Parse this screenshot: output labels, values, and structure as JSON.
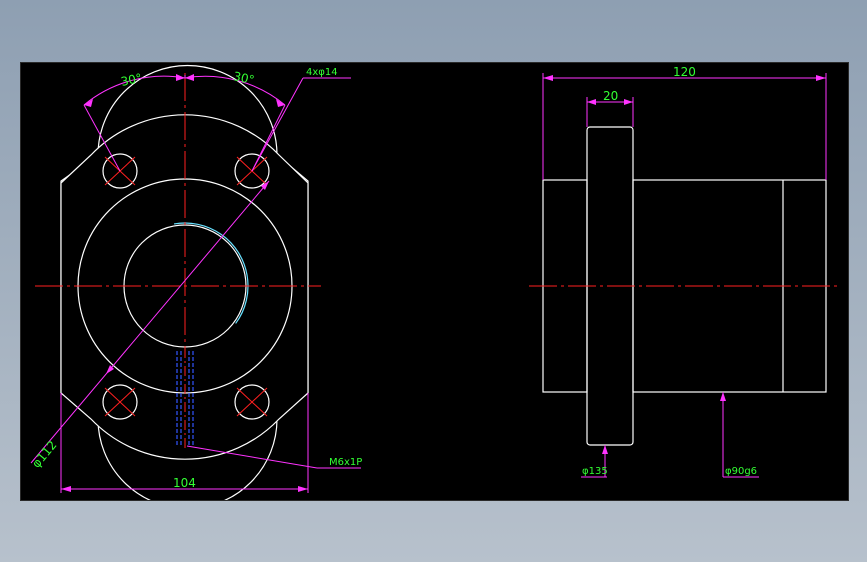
{
  "colors": {
    "background": "#000000",
    "outline": "#ffffff",
    "centerline": "#ff2020",
    "dimension_text": "#33ff33",
    "dimension_line": "#ff33ff",
    "hidden_thread": "#3355ff",
    "bore": "#66e0ff"
  },
  "front_view": {
    "angle_left": "30°",
    "angle_right": "30°",
    "holes_label": "4xφ14 ",
    "pcd_label": "φ112",
    "width_label": "104",
    "thread_label": "M6x1P"
  },
  "side_view": {
    "length_label": "120",
    "flange_thickness_label": "20",
    "flange_dia_label": "φ135",
    "body_dia_label": "φ90g6"
  }
}
